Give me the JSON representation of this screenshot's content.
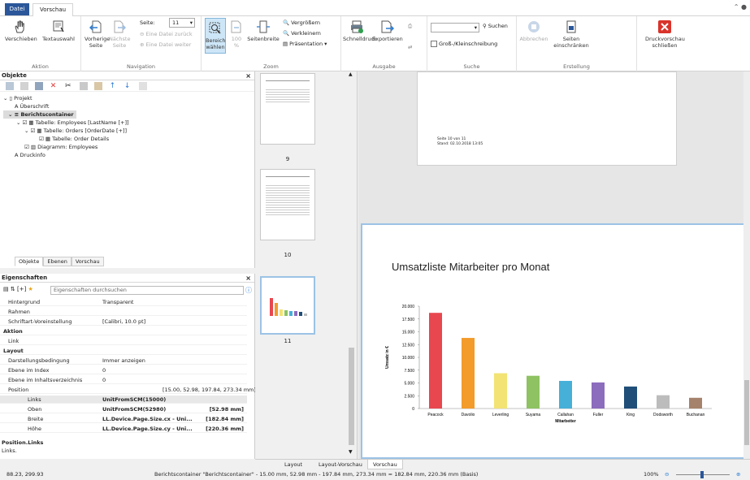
{
  "tabs": {
    "file": "Datei",
    "preview": "Vorschau"
  },
  "ribbon": {
    "aktion": {
      "label": "Aktion",
      "verschieben": "Verschieben",
      "textauswahl": "Textauswahl"
    },
    "navigation": {
      "label": "Navigation",
      "vorherige": "Vorherige Seite",
      "naechste": "Nächste Seite",
      "seite_label": "Seite:",
      "seite_value": "11",
      "zurueck": "Eine Datei zurück",
      "weiter": "Eine Datei weiter"
    },
    "zoom": {
      "label": "Zoom",
      "bereich": "Bereich wählen",
      "hundert": "100 %",
      "seitenbreite": "Seitenbreite",
      "vergroessern": "Vergrößern",
      "verkleinern": "Verkleinern",
      "praesentation": "Präsentation"
    },
    "ausgabe": {
      "label": "Ausgabe",
      "schnelldruck": "Schnelldruck",
      "exportieren": "Exportieren"
    },
    "suche": {
      "label": "Suche",
      "suchen": "Suchen",
      "gross_klein": "Groß-/Kleinschreibung"
    },
    "erstellung": {
      "label": "Erstellung",
      "abbrechen": "Abbrechen",
      "seiten_einschraenken": "Seiten einschränken",
      "schliessen": "Druckvorschau schließen"
    }
  },
  "objects": {
    "title": "Objekte",
    "tree": [
      "Projekt",
      "Überschrift",
      "Berichtscontainer",
      "Tabelle: Employees [LastName [+]]",
      "Tabelle: Orders [OrderDate [+]]",
      "Tabelle: Order Details",
      "Diagramm: Employees",
      "Druckinfo"
    ],
    "tabs": [
      "Objekte",
      "Ebenen",
      "Vorschau"
    ]
  },
  "properties": {
    "title": "Eigenschaften",
    "search_placeholder": "Eigenschaften durchsuchen",
    "rows": [
      {
        "k": "Hintergrund",
        "v": "Transparent"
      },
      {
        "k": "Rahmen",
        "v": ""
      },
      {
        "k": "Schriftart-Voreinstellung",
        "v": "[Calibri, 10.0 pt]"
      },
      {
        "k": "Aktion",
        "v": ""
      },
      {
        "k": "Link",
        "v": ""
      },
      {
        "k": "Layout",
        "v": ""
      },
      {
        "k": "Darstellungsbedingung",
        "v": "Immer anzeigen"
      },
      {
        "k": "Ebene im Index",
        "v": "0"
      },
      {
        "k": "Ebene im Inhaltsverzeichnis",
        "v": "0"
      },
      {
        "k": "Position",
        "v": "[15.00, 52.98, 197.84, 273.34 mm]"
      },
      {
        "k": "Links",
        "v": "UnitFromSCM(15000)",
        "r": ""
      },
      {
        "k": "Oben",
        "v": "UnitFromSCM(52980)",
        "r": "[52.98 mm]"
      },
      {
        "k": "Breite",
        "v": "LL.Device.Page.Size.cx - Uni...",
        "r": "[182.84 mm]"
      },
      {
        "k": "Höhe",
        "v": "LL.Device.Page.Size.cy - Uni...",
        "r": "[220.36 mm]"
      }
    ],
    "desc_title": "Position.Links",
    "desc_text": "Links."
  },
  "thumbs": {
    "n9": "9",
    "n10": "10",
    "n11": "11"
  },
  "preview": {
    "page_footer1": "Seite 10 von 11",
    "page_footer2": "Stand: 02.10.2018 13:05",
    "chart_title": "Umsatzliste Mitarbeiter pro Monat"
  },
  "chart_data": {
    "type": "bar",
    "title": "Umsatzliste Mitarbeiter pro Monat",
    "xlabel": "Mitarbeiter",
    "ylabel": "Umsatz in €",
    "ylim": [
      0,
      20000
    ],
    "yticks": [
      "0",
      "2.500",
      "5.000",
      "7.500",
      "10.000",
      "12.500",
      "15.000",
      "17.500",
      "20.000"
    ],
    "categories": [
      "Peacock",
      "Davolio",
      "Leverling",
      "Suyama",
      "Callahan",
      "Fuller",
      "King",
      "Dodsworth",
      "Buchanan"
    ],
    "values": [
      18700,
      13800,
      6900,
      6400,
      5400,
      5100,
      4300,
      2600,
      2100
    ],
    "colors": [
      "#e8474f",
      "#f39b2b",
      "#f2e374",
      "#8ec262",
      "#46b0d8",
      "#8c6cbd",
      "#1f4e79",
      "#bcbcbc",
      "#a5826b"
    ]
  },
  "bottom_tabs": [
    "Layout",
    "Layout-Vorschau",
    "Vorschau"
  ],
  "status": {
    "coords": "88.23, 299.93",
    "info": "Berichtscontainer \"Berichtscontainer\" - 15.00 mm, 52.98 mm - 197.84 mm, 273.34 mm = 182.84 mm, 220.36 mm (Basis)",
    "zoom": "100%"
  }
}
